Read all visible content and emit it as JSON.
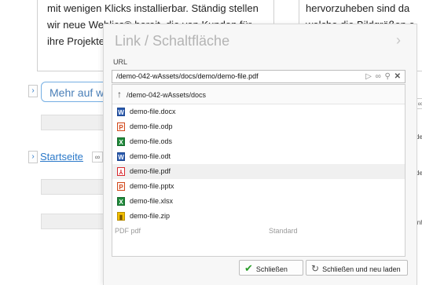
{
  "background": {
    "left_lines": [
      "mit wenigen Klicks installierbar. Ständig stellen",
      "wir neue Weblics® bereit, die von Kunden für",
      "ihre Projekte"
    ],
    "right_lines": [
      "hervorzuheben sind da",
      "welche die Bildgrößen e",
      "nt",
      "tim"
    ],
    "more_button": "Mehr auf w",
    "start_link": "Startseite",
    "right_fragments": [
      "de",
      "der",
      "inh"
    ],
    "peek_left": "PDF  pdf",
    "peek_right": "Standard"
  },
  "dialog": {
    "title": "Link / Schaltfläche",
    "url_label": "URL",
    "url_value": "/demo-042-wAssets/docs/demo/demo-file.pdf",
    "up_entry": "/demo-042-wAssets/docs",
    "files": [
      {
        "name": "demo-file.docx",
        "icon": "word-icon",
        "glyph": "W"
      },
      {
        "name": "demo-file.odp",
        "icon": "presentation-icon",
        "glyph": "P"
      },
      {
        "name": "demo-file.ods",
        "icon": "spreadsheet-icon",
        "glyph": "X"
      },
      {
        "name": "demo-file.odt",
        "icon": "word-icon",
        "glyph": "W"
      },
      {
        "name": "demo-file.pdf",
        "icon": "pdf-icon",
        "glyph": "⅄"
      },
      {
        "name": "demo-file.pptx",
        "icon": "presentation-icon",
        "glyph": "P"
      },
      {
        "name": "demo-file.xlsx",
        "icon": "spreadsheet-icon",
        "glyph": "X"
      },
      {
        "name": "demo-file.zip",
        "icon": "zip-icon",
        "glyph": "▮"
      }
    ],
    "close_label": "Schließen",
    "close_reload_label": "Schließen und neu laden"
  },
  "colors": {
    "accent": "#2b79c9",
    "check": "#2a9d2a"
  }
}
